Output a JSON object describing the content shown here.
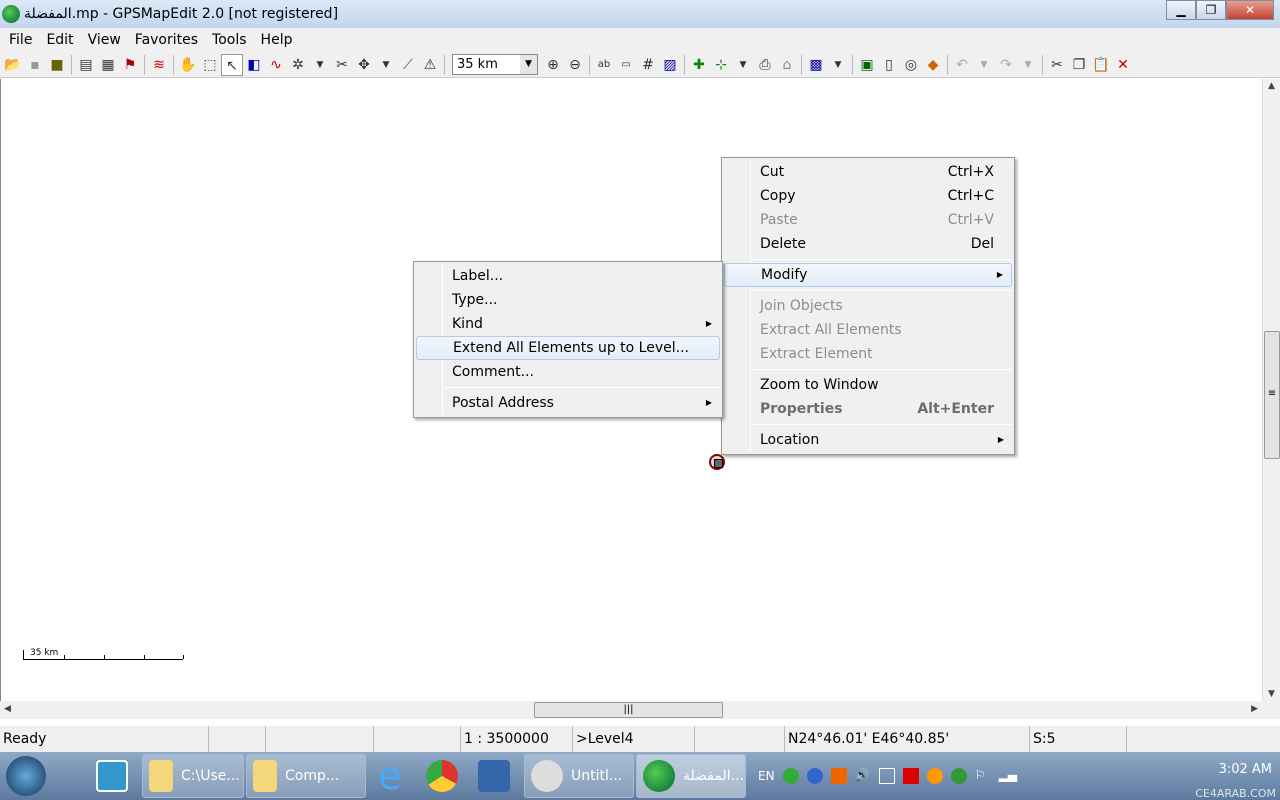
{
  "window": {
    "title": "المفضلة.mp - GPSMapEdit 2.0 [not registered]",
    "minimize": "▁",
    "restore": "❐",
    "close": "✕"
  },
  "menu": [
    "File",
    "Edit",
    "View",
    "Favorites",
    "Tools",
    "Help"
  ],
  "toolbar": {
    "scale_value": "35 km",
    "icons1": [
      "open-icon",
      "save-icon",
      "export-icon"
    ],
    "scale_dropdown_arrow": "▼"
  },
  "map": {
    "scale_label": "35 km"
  },
  "context_menu": {
    "items": [
      {
        "label": "Cut",
        "shortcut": "Ctrl+X"
      },
      {
        "label": "Copy",
        "shortcut": "Ctrl+C"
      },
      {
        "label": "Paste",
        "shortcut": "Ctrl+V",
        "disabled": true
      },
      {
        "label": "Delete",
        "shortcut": "Del"
      },
      {
        "label": "Modify"
      },
      {
        "label": "Join Objects",
        "disabled": true
      },
      {
        "label": "Extract All Elements",
        "disabled": true
      },
      {
        "label": "Extract Element",
        "disabled": true
      },
      {
        "label": "Zoom to Window"
      },
      {
        "label": "Properties",
        "shortcut": "Alt+Enter"
      },
      {
        "label": "Location"
      }
    ]
  },
  "submenu": {
    "items": [
      {
        "label": "Label..."
      },
      {
        "label": "Type..."
      },
      {
        "label": "Kind"
      },
      {
        "label": "Extend All Elements up to Level..."
      },
      {
        "label": "Comment..."
      },
      {
        "label": "Postal Address"
      }
    ]
  },
  "status": {
    "ready": "Ready",
    "scale": "1 : 3500000",
    "level": ">Level4",
    "coords": "N24°46.01' E46°40.85'",
    "s": "S:5"
  },
  "taskbar": {
    "items": [
      "C:\\Use...",
      "Comp...",
      "Untitl...",
      "المفضلة..."
    ],
    "lang": "EN",
    "clock": "3:02 AM"
  },
  "watermark": {
    "text": "CE4ARAB.COM"
  }
}
